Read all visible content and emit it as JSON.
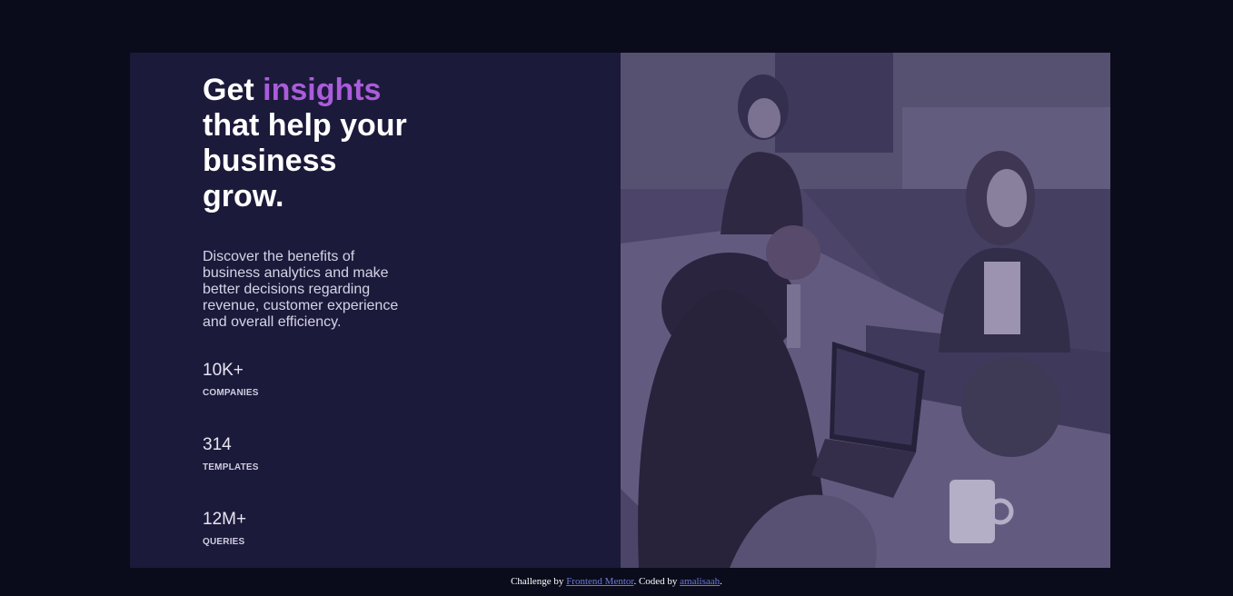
{
  "hero": {
    "title_prefix": "Get ",
    "title_accent": "insights",
    "title_rest": " that help your business grow.",
    "description": "Discover the benefits of business analytics and make better decisions regarding revenue, customer experience and overall efficiency."
  },
  "stats": [
    {
      "value": "10K+",
      "label": "COMPANIES"
    },
    {
      "value": "314",
      "label": "TEMPLATES"
    },
    {
      "value": "12M+",
      "label": "QUERIES"
    }
  ],
  "footer": {
    "text_1": "Challenge by ",
    "link_1": "Frontend Mentor",
    "text_2": ". Coded by ",
    "link_2": "amalisaah",
    "text_3": "."
  },
  "colors": {
    "page_bg": "#0a0c1c",
    "card_bg": "#1c1a3a",
    "accent": "#ab5cdb",
    "photo_tint": "#4a4760"
  }
}
